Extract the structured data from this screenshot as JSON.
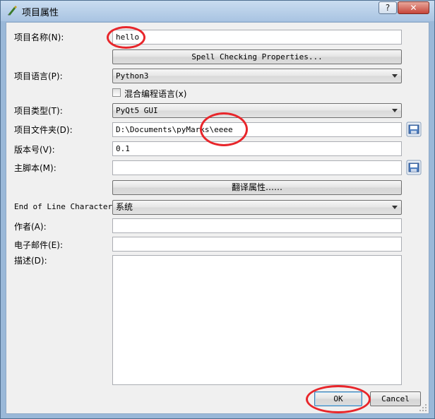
{
  "window": {
    "title": "项目属性",
    "help_label": "?",
    "close_label": "✕"
  },
  "form": {
    "project_name_label": "项目名称(N):",
    "project_name_value": "hello",
    "spell_button": "Spell Checking Properties...",
    "language_label": "项目语言(P):",
    "language_value": "Python3",
    "mixed_language_label": "混合编程语言(x)",
    "mixed_language_checked": false,
    "type_label": "项目类型(T):",
    "type_value": "PyQt5 GUI",
    "folder_label": "项目文件夹(D):",
    "folder_value": "D:\\Documents\\pyMarks\\eeee",
    "version_label": "版本号(V):",
    "version_value": "0.1",
    "main_script_label": "主脚本(M):",
    "main_script_value": "",
    "translation_button": "翻译属性……",
    "eol_label": "End of Line Character:",
    "eol_value": "系统",
    "author_label": "作者(A):",
    "author_value": "",
    "email_label": "电子邮件(E):",
    "email_value": "",
    "description_label": "描述(D):",
    "description_value": ""
  },
  "buttons": {
    "ok": "OK",
    "cancel": "Cancel"
  },
  "annotations": {
    "circle_color": "#e8262b"
  }
}
